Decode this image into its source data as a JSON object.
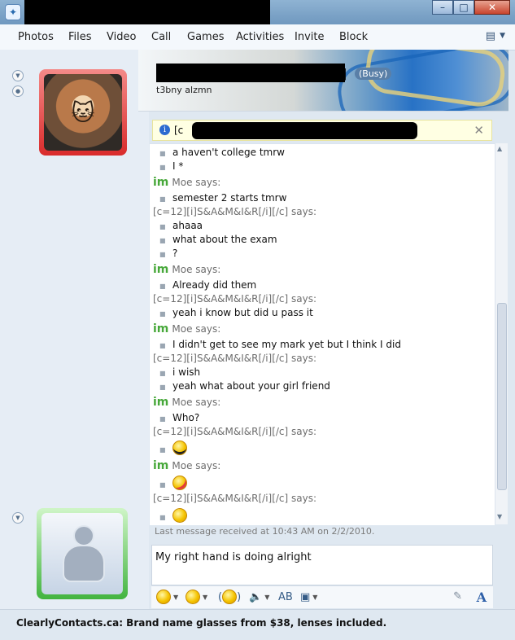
{
  "toolbar": {
    "items": [
      "Photos",
      "Files",
      "Video",
      "Call",
      "Games",
      "Activities",
      "Invite",
      "Block"
    ]
  },
  "contact": {
    "name_suffix": "]",
    "status": "(Busy)",
    "personal_message": "t3bny alzmn",
    "info_bar_prefix": "[c"
  },
  "chat": {
    "lines": [
      {
        "kind": "message",
        "text": "a haven't college tmrw"
      },
      {
        "kind": "message",
        "text": "I *"
      },
      {
        "kind": "speaker",
        "text": "Moe says:",
        "im": "im"
      },
      {
        "kind": "message",
        "text": "semester 2 starts tmrw"
      },
      {
        "kind": "speaker",
        "text": "[c=12][i]S&A&M&I&R[/i][/c] says:"
      },
      {
        "kind": "message",
        "text": "ahaaa"
      },
      {
        "kind": "message",
        "text": "what about the exam"
      },
      {
        "kind": "message",
        "text": "?"
      },
      {
        "kind": "speaker",
        "text": "Moe says:",
        "im": "im"
      },
      {
        "kind": "message",
        "text": "Already did them"
      },
      {
        "kind": "speaker",
        "text": "[c=12][i]S&A&M&I&R[/i][/c] says:"
      },
      {
        "kind": "message",
        "text": "yeah i know but did u pass it"
      },
      {
        "kind": "speaker",
        "text": "Moe says:",
        "im": "im"
      },
      {
        "kind": "message",
        "text": "I didn't get to see my mark yet but I think I did"
      },
      {
        "kind": "speaker",
        "text": "[c=12][i]S&A&M&I&R[/i][/c] says:"
      },
      {
        "kind": "message",
        "text": "i wish"
      },
      {
        "kind": "message",
        "text": "yeah what about your girl friend"
      },
      {
        "kind": "speaker",
        "text": "Moe says:",
        "im": "im"
      },
      {
        "kind": "message",
        "text": "Who?"
      },
      {
        "kind": "speaker",
        "text": "[c=12][i]S&A&M&I&R[/i][/c] says:"
      },
      {
        "kind": "emoticon",
        "icon": "cool-smiley-icon"
      },
      {
        "kind": "speaker",
        "text": "Moe says:",
        "im": "im"
      },
      {
        "kind": "emoticon",
        "icon": "tongue-smiley-icon"
      },
      {
        "kind": "speaker",
        "text": "[c=12][i]S&A&M&I&R[/i][/c] says:"
      },
      {
        "kind": "emoticon",
        "icon": "wink-smiley-icon"
      }
    ],
    "last_message": "Last message received at 10:43 AM on 2/2/2010."
  },
  "compose": {
    "text": "My right hand is doing alright"
  },
  "ad": {
    "text": "ClearlyContacts.ca: Brand name glasses from $38, lenses included."
  },
  "icons": {
    "app": "messenger-icon",
    "info": "info-icon",
    "close": "close-icon",
    "emoticon": "smiley-icon",
    "wink": "wink-icon",
    "nudge": "nudge-icon",
    "voice": "voice-clip-icon",
    "font": "font-icon",
    "ink": "handwriting-icon"
  }
}
